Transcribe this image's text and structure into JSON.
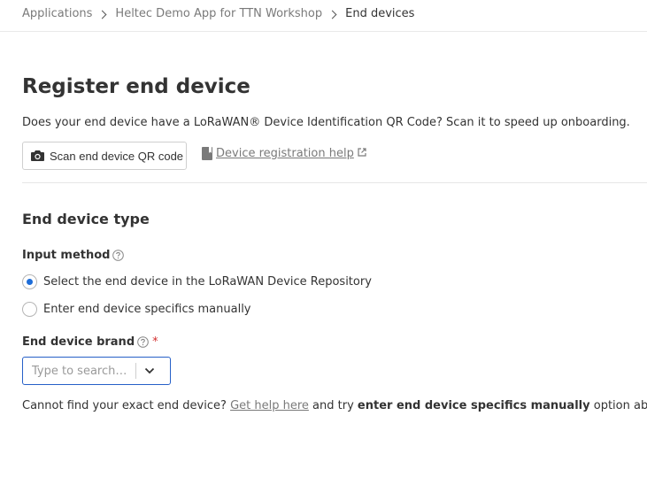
{
  "breadcrumb": {
    "items": [
      "Applications",
      "Heltec Demo App for TTN Workshop"
    ],
    "current": "End devices"
  },
  "page": {
    "title": "Register end device",
    "qr_question": "Does your end device have a LoRaWAN® Device Identification QR Code? Scan it to speed up onboarding.",
    "scan_button_label": "Scan end device QR code",
    "help_link_label": "Device registration help"
  },
  "end_device_type": {
    "section_title": "End device type",
    "input_method_label": "Input method",
    "options": [
      {
        "label": "Select the end device in the LoRaWAN Device Repository",
        "selected": true
      },
      {
        "label": "Enter end device specifics manually",
        "selected": false
      }
    ],
    "brand_label": "End device brand",
    "required_marker": "*",
    "brand_placeholder": "Type to search…"
  },
  "footer": {
    "prefix": "Cannot find your exact end device?",
    "link": "Get help here",
    "middle": "and try",
    "bold": "enter end device specifics manually",
    "suffix": "option above."
  },
  "colors": {
    "accent": "#1e6dd8",
    "select_border": "#2660c8",
    "required": "#d32f2f",
    "muted_text": "#7a7a7a"
  },
  "icons": [
    "chevron-right-icon",
    "camera-icon",
    "book-icon",
    "external-link-icon",
    "question-circle-icon",
    "chevron-down-icon"
  ]
}
